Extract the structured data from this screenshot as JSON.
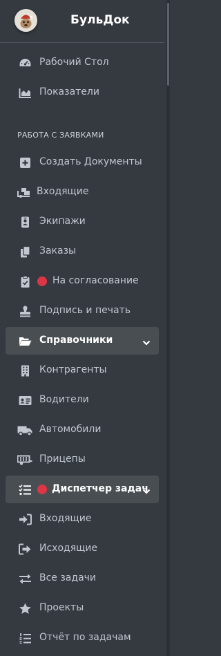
{
  "brand": {
    "title": "БульДок",
    "logo_icon": "bulldog-logo-icon"
  },
  "nav_top": [
    {
      "label": "Рабочий Стол",
      "icon": "dashboard-icon"
    },
    {
      "label": "Показатели",
      "icon": "area-chart-icon"
    }
  ],
  "section_header": "РАБОТА С ЗАЯВКАМИ",
  "nav_requests": [
    {
      "label": "Создать Документы",
      "icon": "plus-square-icon"
    },
    {
      "label": "Входящие",
      "icon": "truck-loading-icon"
    },
    {
      "label": "Экипажи",
      "icon": "id-badge-icon"
    },
    {
      "label": "Заказы",
      "icon": "copy-icon"
    },
    {
      "label": "На согласование",
      "icon": "clipboard-check-icon",
      "badge": "red-dot"
    },
    {
      "label": "Подпись и печать",
      "icon": "stamp-icon"
    }
  ],
  "directory": {
    "label": "Справочники",
    "icon": "folder-open-icon",
    "expanded": true,
    "items": [
      {
        "label": "Контрагенты",
        "icon": "building-icon"
      },
      {
        "label": "Водители",
        "icon": "id-card-icon"
      },
      {
        "label": "Автомобили",
        "icon": "truck-icon"
      },
      {
        "label": "Прицепы",
        "icon": "trailer-icon"
      }
    ]
  },
  "dispatcher": {
    "label": "Диспетчер задач",
    "icon": "tasks-icon",
    "badge": "red-dot",
    "expanded": true,
    "items": [
      {
        "label": "Входящие",
        "icon": "sign-in-icon"
      },
      {
        "label": "Исходящие",
        "icon": "sign-out-icon"
      },
      {
        "label": "Все задачи",
        "icon": "exchange-icon"
      },
      {
        "label": "Проекты",
        "icon": "star-icon"
      },
      {
        "label": "Отчёт по задачам",
        "icon": "list-ol-icon"
      }
    ]
  },
  "colors": {
    "sidebar_bg": "#343a40",
    "active_bg": "#494e53",
    "text": "#c2c7d0",
    "badge": "#dc3545"
  }
}
